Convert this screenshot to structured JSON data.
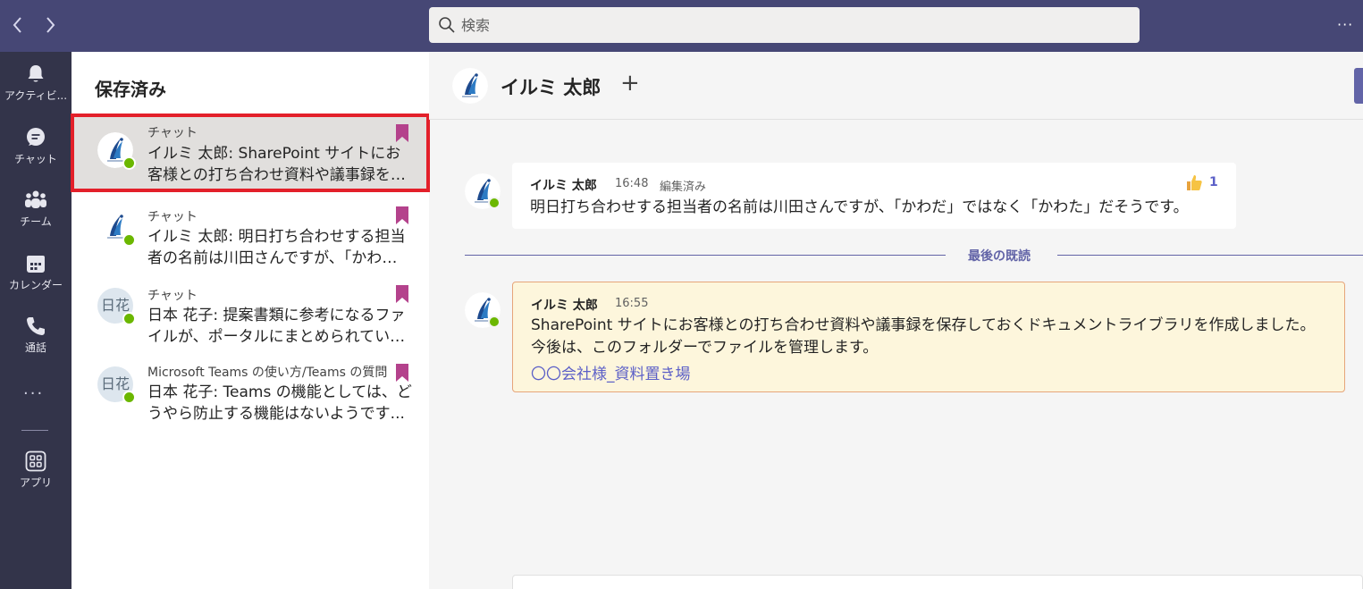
{
  "topbar": {
    "back_label": "‹",
    "forward_label": "›",
    "search_placeholder": "検索",
    "more_label": "···"
  },
  "rail": {
    "items": [
      {
        "icon": "bell-icon",
        "label": "アクティビ..."
      },
      {
        "icon": "chat-icon",
        "label": "チャット"
      },
      {
        "icon": "teams-icon",
        "label": "チーム"
      },
      {
        "icon": "calendar-icon",
        "label": "カレンダー"
      },
      {
        "icon": "phone-icon",
        "label": "通話"
      }
    ],
    "more_label": "···",
    "apps": {
      "icon": "apps-icon",
      "label": "アプリ"
    }
  },
  "saved": {
    "title": "保存済み",
    "items": [
      {
        "context": "チャット",
        "preview": "イルミ 太郎: SharePoint サイトにお客様との打ち合わせ資料や議事録を保存...",
        "avatar": "logo",
        "selected": true
      },
      {
        "context": "チャット",
        "preview": "イルミ 太郎: 明日打ち合わせする担当者の名前は川田さんですが、「かわだ」...",
        "avatar": "logo",
        "selected": false
      },
      {
        "context": "チャット",
        "preview": "日本 花子: 提案書類に参考になるファイルが、ポータルにまとめられていま...",
        "avatar": "initials",
        "initials": "日花",
        "selected": false
      },
      {
        "context": "Microsoft Teams の使い方/Teams の質問",
        "preview": "日本 花子: Teams の機能としては、どうやら防止する機能はないようです...",
        "avatar": "initials",
        "initials": "日花",
        "selected": false
      }
    ]
  },
  "chat": {
    "header": {
      "name": "イルミ 太郎",
      "add_label": "+"
    },
    "messages": [
      {
        "author": "イルミ 太郎",
        "time": "16:48",
        "edited": "編集済み",
        "text": "明日打ち合わせする担当者の名前は川田さんですが、「かわだ」ではなく「かわた」だそうです。",
        "reaction": {
          "icon": "thumbs-up-icon",
          "count": "1"
        }
      },
      {
        "author": "イルミ 太郎",
        "time": "16:55",
        "lines": [
          "SharePoint サイトにお客様との打ち合わせ資料や議事録を保存しておくドキュメントライブラリを作成しました。",
          "今後は、このフォルダーでファイルを管理します。"
        ],
        "link": "〇〇会社様_資料置き場"
      }
    ],
    "last_read_label": "最後の既読"
  },
  "colors": {
    "topbar": "#464775",
    "rail": "#33344a",
    "accent": "#6264a7",
    "selected_outline": "#e3202a",
    "bookmark": "#b4428c",
    "presence": "#6bb700",
    "highlight_bg": "#fdf6dc",
    "highlight_border": "#e6a57a"
  }
}
